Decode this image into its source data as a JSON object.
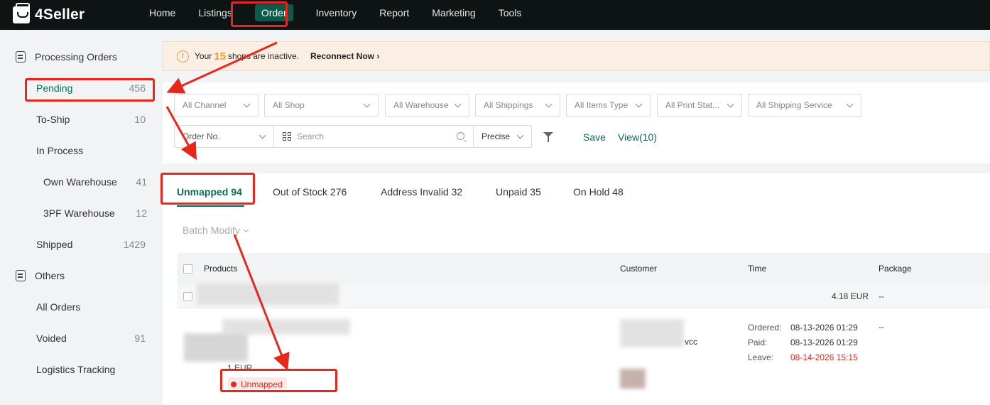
{
  "brand": {
    "name": "4Seller"
  },
  "nav": {
    "items": [
      "Home",
      "Listings",
      "Order",
      "Inventory",
      "Report",
      "Marketing",
      "Tools"
    ],
    "active": "Order"
  },
  "sidebar": {
    "group1": "Processing Orders",
    "items1": [
      {
        "label": "Pending",
        "count": "456"
      },
      {
        "label": "To-Ship",
        "count": "10"
      },
      {
        "label": "In Process",
        "count": ""
      },
      {
        "label": "Own Warehouse",
        "count": "41"
      },
      {
        "label": "3PF Warehouse",
        "count": "12"
      },
      {
        "label": "Shipped",
        "count": "1429"
      }
    ],
    "group2": "Others",
    "items2": [
      {
        "label": "All Orders",
        "count": ""
      },
      {
        "label": "Voided",
        "count": "91"
      },
      {
        "label": "Logistics Tracking",
        "count": ""
      }
    ]
  },
  "banner": {
    "prefix": "Your",
    "count": "15",
    "suffix": "shops are inactive.",
    "link": "Reconnect Now ›"
  },
  "filters": {
    "selects": [
      "All Channel",
      "All Shop",
      "All Warehouse",
      "All Shippings",
      "All Items Type",
      "All Print Stat...",
      "All Shipping Service"
    ],
    "order_field": "Order No.",
    "search_placeholder": "Search",
    "match_mode": "Precise",
    "save": "Save",
    "view": "View(10)"
  },
  "tabs": [
    "Unmapped 94",
    "Out of Stock 276",
    "Address Invalid 32",
    "Unpaid 35",
    "On Hold 48"
  ],
  "batch_modify": "Batch Modify",
  "table": {
    "headers": [
      "Products",
      "Customer",
      "Time",
      "Package"
    ],
    "summary_amount": "4.18 EUR",
    "summary_package": "--",
    "product_price": "1 EUR",
    "tag": "Unmapped",
    "customer_tail": "vcc",
    "time": [
      {
        "label": "Ordered:",
        "value": "08-13-2026 01:29"
      },
      {
        "label": "Paid:",
        "value": "08-13-2026 01:29"
      },
      {
        "label": "Leave:",
        "value": "08-14-2026 15:15"
      }
    ],
    "package": "--"
  },
  "colors": {
    "accent": "#0b6b58",
    "annotation": "#e8261c",
    "topbar": "#0e1414"
  }
}
